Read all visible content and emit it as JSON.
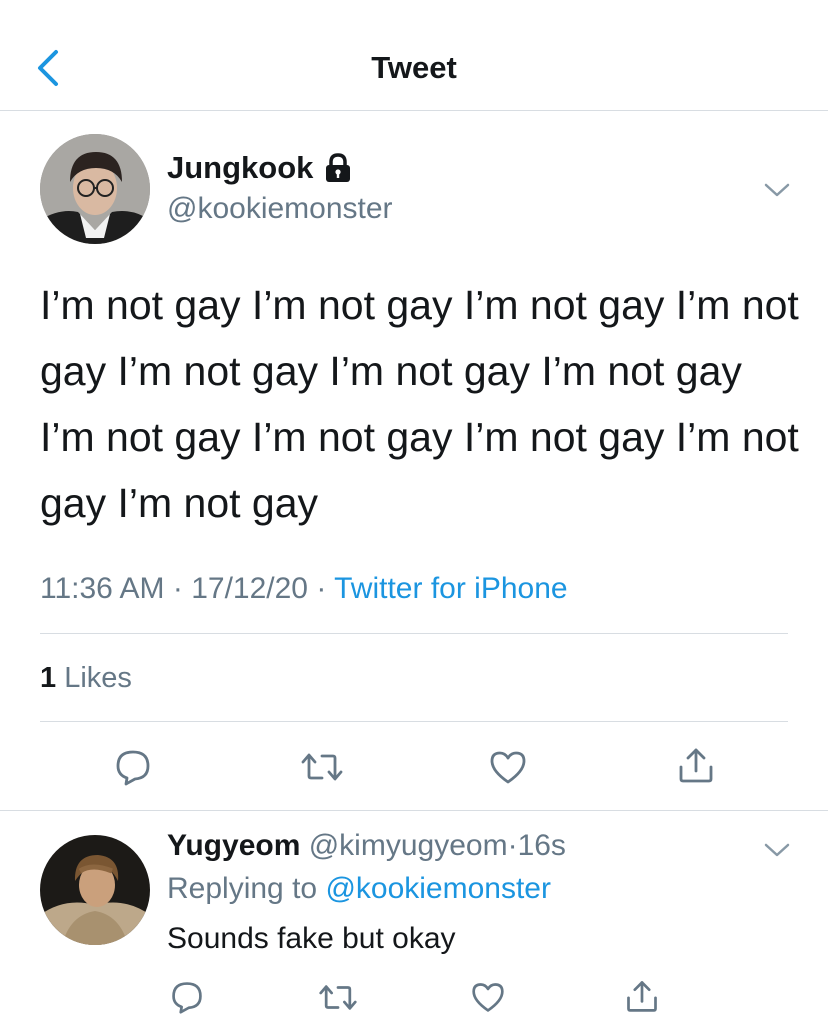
{
  "header": {
    "title": "Tweet"
  },
  "tweet": {
    "author": {
      "display_name": "Jungkook",
      "handle": "@kookiemonster",
      "protected": true
    },
    "text": "I’m not gay I’m not gay I’m not gay I’m not gay I’m not gay I’m not gay I’m not gay I’m not gay I’m not gay I’m not gay I’m not gay I’m not gay",
    "time": "11:36 AM",
    "date": "17/12/20",
    "separator": "·",
    "source": "Twitter for iPhone",
    "likes_count": "1",
    "likes_label": "Likes",
    "actions": [
      "reply-icon",
      "retweet-icon",
      "like-icon",
      "share-icon"
    ]
  },
  "reply": {
    "display_name": "Yugyeom",
    "handle": "@kimyugyeom",
    "separator": "·",
    "time": "16s",
    "replying_prefix": "Replying to",
    "replying_to": "@kookiemonster",
    "text": "Sounds fake but okay",
    "actions": [
      "reply-icon",
      "retweet-icon",
      "like-icon",
      "share-icon"
    ]
  },
  "colors": {
    "accent": "#1b95e0",
    "text": "#14171a",
    "secondary": "#657786",
    "divider": "#d8dde2"
  }
}
